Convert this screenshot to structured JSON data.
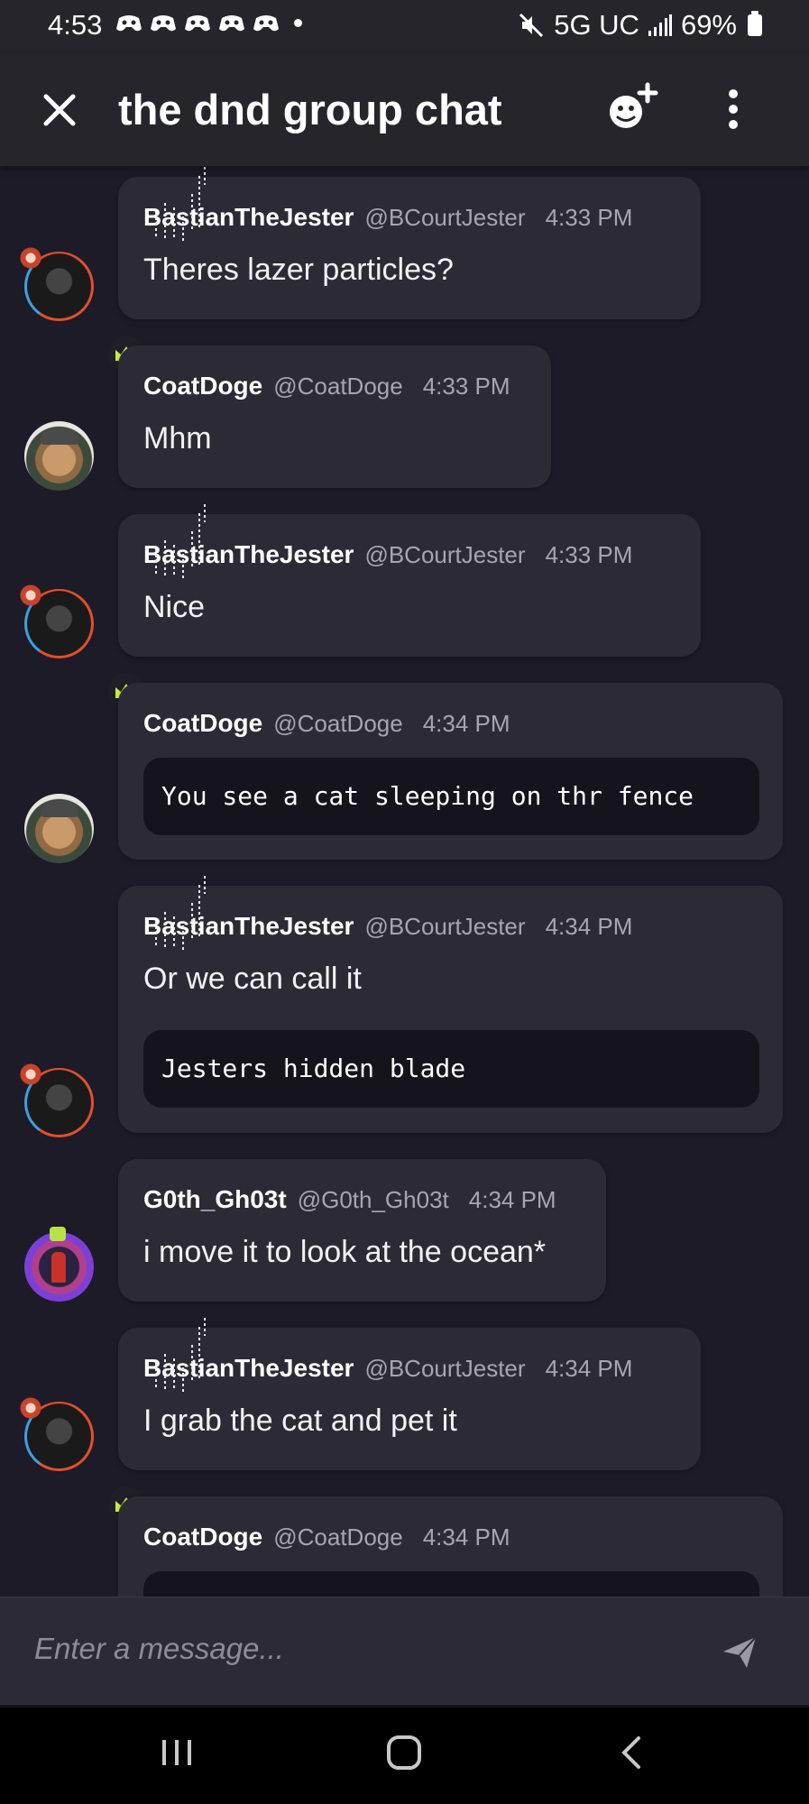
{
  "status_bar": {
    "time": "4:53",
    "network": "5G UC",
    "battery": "69%"
  },
  "header": {
    "title": "the dnd group chat"
  },
  "messages": [
    {
      "user": "BastianTheJester",
      "handle": "@BCourtJester",
      "time": "4:33 PM",
      "text": "Theres lazer particles?"
    },
    {
      "user": "CoatDoge",
      "handle": "@CoatDoge",
      "time": "4:33 PM",
      "text": "Mhm"
    },
    {
      "user": "BastianTheJester",
      "handle": "@BCourtJester",
      "time": "4:33 PM",
      "text": "Nice"
    },
    {
      "user": "CoatDoge",
      "handle": "@CoatDoge",
      "time": "4:34 PM",
      "code": "You see a cat sleeping on thr fence"
    },
    {
      "user": "BastianTheJester",
      "handle": "@BCourtJester",
      "time": "4:34 PM",
      "text": "Or we can call it",
      "code": "Jesters hidden blade"
    },
    {
      "user": "G0th_Gh03t",
      "handle": "@G0th_Gh03t",
      "time": "4:34 PM",
      "text": "i move it to look at the ocean*"
    },
    {
      "user": "BastianTheJester",
      "handle": "@BCourtJester",
      "time": "4:34 PM",
      "text": "I grab the cat and pet it"
    },
    {
      "user": "CoatDoge",
      "handle": "@CoatDoge",
      "time": "4:34 PM"
    }
  ],
  "composer": {
    "placeholder": "Enter a message..."
  },
  "colors": {
    "background": "#1c1b27",
    "bubble": "#2c2b35",
    "code_block": "#15141c",
    "crown": "#c9f23a"
  }
}
